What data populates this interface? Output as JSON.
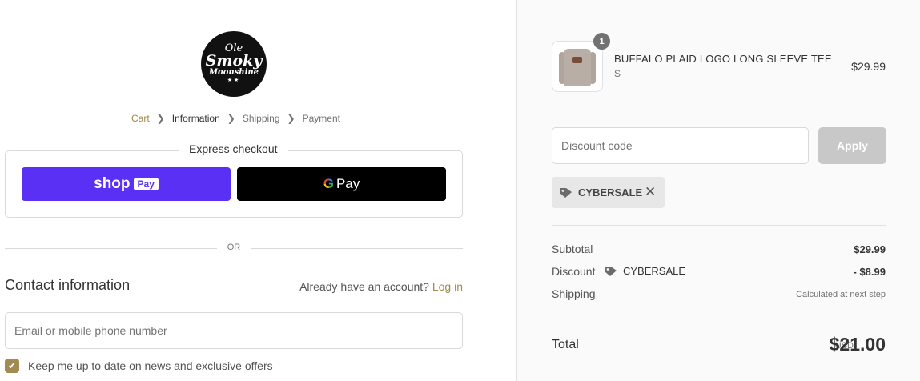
{
  "brand": {
    "logo_line1": "Ole",
    "logo_line2": "Smoky",
    "logo_line3": "Moonshine",
    "logo_line4": "★★"
  },
  "breadcrumb": [
    "Cart",
    "Information",
    "Shipping",
    "Payment"
  ],
  "express": {
    "title": "Express checkout",
    "shop_pay_label_a": "shop",
    "shop_pay_label_b": "Pay",
    "gpay_label_g": "G",
    "gpay_label_pay": "Pay"
  },
  "divider": {
    "or": "OR"
  },
  "contact": {
    "title": "Contact information",
    "account_prompt": "Already have an account?",
    "login_label": "Log in",
    "email_placeholder": "Email or mobile phone number",
    "newsletter_label": "Keep me up to date on news and exclusive offers",
    "newsletter_checked": true
  },
  "cart": {
    "items": [
      {
        "name": "BUFFALO PLAID LOGO LONG SLEEVE TEE",
        "variant": "S",
        "price": "$29.99",
        "quantity": "1"
      }
    ]
  },
  "discount": {
    "placeholder": "Discount code",
    "apply_label": "Apply",
    "applied_code": "CYBERSALE"
  },
  "summary": {
    "subtotal_label": "Subtotal",
    "subtotal_value": "$29.99",
    "discount_label": "Discount",
    "discount_code": "CYBERSALE",
    "discount_value": "- $8.99",
    "shipping_label": "Shipping",
    "shipping_value": "Calculated at next step",
    "total_label": "Total",
    "currency": "USD",
    "total_value": "$21.00"
  },
  "colors": {
    "accent": "#a28b52",
    "shop_pay": "#5a31f4",
    "gpay": "#000000"
  }
}
